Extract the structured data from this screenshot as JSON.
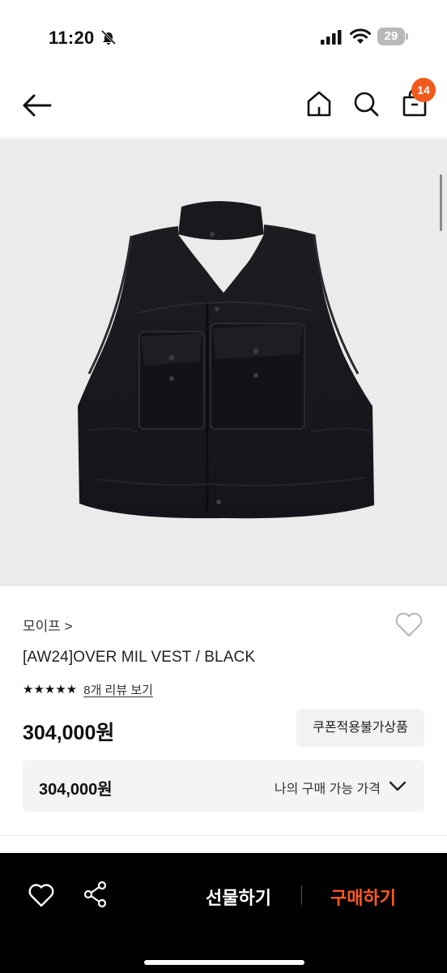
{
  "status_bar": {
    "time": "11:20",
    "battery": "29"
  },
  "nav": {
    "cart_badge": "14"
  },
  "product": {
    "brand": "모이프 >",
    "title": "[AW24]OVER MIL VEST / BLACK",
    "stars": "★★★★★",
    "rating_stars": 5,
    "reviews_link": "8개 리뷰 보기",
    "price": "304,000원",
    "coupon_label": "쿠폰적용불가상품",
    "my_price": "304,000원",
    "my_price_label": "나의 구매 가능 가격"
  },
  "bottom_bar": {
    "gift_label": "선물하기",
    "buy_label": "구매하기"
  },
  "colors": {
    "accent": "#f25a1c",
    "buy_text": "#ff5a1f",
    "hero_bg": "#ebebeb",
    "bottom_bg": "#000000"
  }
}
